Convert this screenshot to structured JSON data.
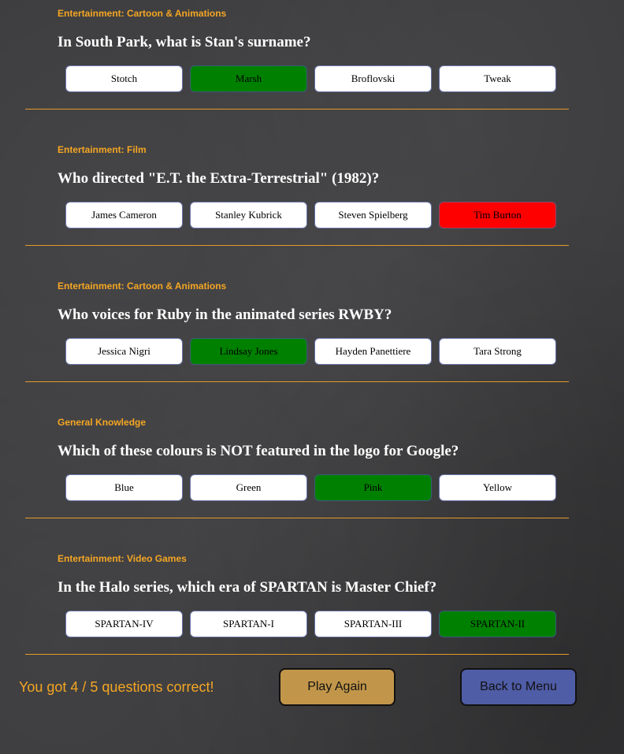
{
  "questions": [
    {
      "category": "Entertainment: Cartoon & Animations",
      "question": "In South Park, what is Stan's surname?",
      "answers": [
        {
          "label": "Stotch",
          "state": "default"
        },
        {
          "label": "Marsh",
          "state": "correct"
        },
        {
          "label": "Broflovski",
          "state": "default"
        },
        {
          "label": "Tweak",
          "state": "default"
        }
      ]
    },
    {
      "category": "Entertainment: Film",
      "question": "Who directed \"E.T. the Extra-Terrestrial\" (1982)?",
      "answers": [
        {
          "label": "James Cameron",
          "state": "default"
        },
        {
          "label": "Stanley Kubrick",
          "state": "default"
        },
        {
          "label": "Steven Spielberg",
          "state": "default"
        },
        {
          "label": "Tim Burton",
          "state": "wrong"
        }
      ]
    },
    {
      "category": "Entertainment: Cartoon & Animations",
      "question": "Who voices for Ruby in the animated series RWBY?",
      "answers": [
        {
          "label": "Jessica Nigri",
          "state": "default"
        },
        {
          "label": "Lindsay Jones",
          "state": "correct"
        },
        {
          "label": "Hayden Panettiere",
          "state": "default"
        },
        {
          "label": "Tara Strong",
          "state": "default"
        }
      ]
    },
    {
      "category": "General Knowledge",
      "question": "Which of these colours is NOT featured in the logo for Google?",
      "answers": [
        {
          "label": "Blue",
          "state": "default"
        },
        {
          "label": "Green",
          "state": "default"
        },
        {
          "label": "Pink",
          "state": "correct"
        },
        {
          "label": "Yellow",
          "state": "default"
        }
      ]
    },
    {
      "category": "Entertainment: Video Games",
      "question": "In the Halo series, which era of SPARTAN is Master Chief?",
      "answers": [
        {
          "label": "SPARTAN-IV",
          "state": "default"
        },
        {
          "label": "SPARTAN-I",
          "state": "default"
        },
        {
          "label": "SPARTAN-III",
          "state": "default"
        },
        {
          "label": "SPARTAN-II",
          "state": "correct"
        }
      ]
    }
  ],
  "footer": {
    "score_text": "You got 4 / 5 questions correct!",
    "play_again_label": "Play Again",
    "back_to_menu_label": "Back to Menu"
  },
  "colors": {
    "accent_orange": "#f5a623",
    "correct_green": "#008000",
    "wrong_red": "#ff0000",
    "play_again_bg": "#c2964a",
    "back_to_menu_bg": "#4f5ca6"
  }
}
